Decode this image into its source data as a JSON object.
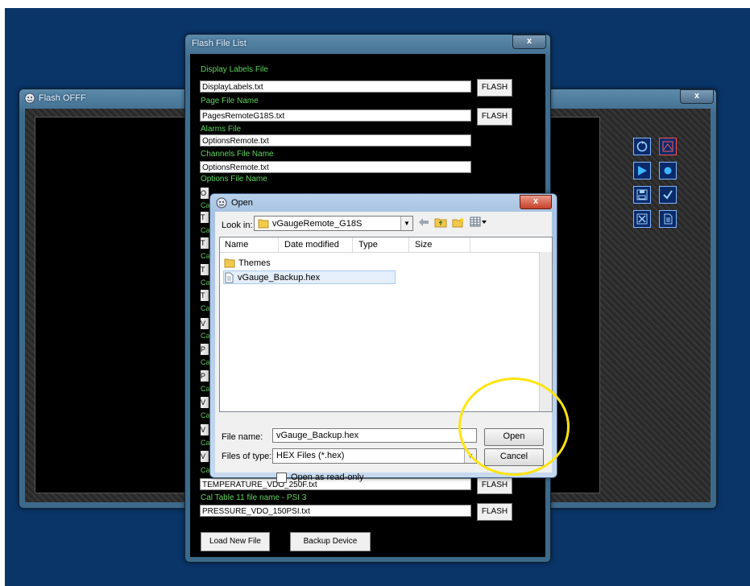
{
  "main_window": {
    "title": "Flash OFFF",
    "close": "x"
  },
  "file_list": {
    "title": "Flash File List",
    "close": "x",
    "fields": [
      {
        "label": "Display Labels File",
        "value": "DisplayLabels.txt",
        "button": "FLASH"
      },
      {
        "label": "Page File Name",
        "value": "PagesRemoteG18S.txt",
        "button": "FLASH"
      },
      {
        "label": "Alarms File",
        "value": "OptionsRemote.txt"
      },
      {
        "label": "Channels File Name",
        "value": "OptionsRemote.txt"
      },
      {
        "label": "Options File Name"
      }
    ],
    "partial_rows": [
      {
        "label": "Ca",
        "value": "O"
      },
      {
        "label": "Ca",
        "value": "T"
      },
      {
        "label": "Ca",
        "value": "T"
      },
      {
        "label": "Ca",
        "value": "T"
      },
      {
        "label": "Ca",
        "value": "T"
      },
      {
        "label": "Ca",
        "value": "V"
      },
      {
        "label": "Ca",
        "value": "P"
      },
      {
        "label": "Ca",
        "value": "P"
      },
      {
        "label": "Ca",
        "value": "V"
      },
      {
        "label": "Ca",
        "value": "V"
      },
      {
        "label": "Ca",
        "value": "V"
      }
    ],
    "bottom_fields": [
      {
        "label": "Ca",
        "value": "TEMPERATURE_VDO_250F.txt",
        "button": "FLASH"
      },
      {
        "label": "Cal Table 11 file name - PSI 3",
        "value": "PRESSURE_VDO_150PSI.txt",
        "button": "FLASH"
      }
    ],
    "load_button": "Load New File",
    "backup_button": "Backup Device"
  },
  "open_dialog": {
    "title": "Open",
    "close": "x",
    "look_in_label": "Look in:",
    "look_in_value": "vGaugeRemote_G18S",
    "columns": [
      "Name",
      "Date modified",
      "Type",
      "Size"
    ],
    "items": [
      {
        "name": "Themes",
        "icon": "folder-icon"
      },
      {
        "name": "vGauge_Backup.hex",
        "icon": "file-icon",
        "selected": true
      }
    ],
    "file_name_label": "File name:",
    "file_name_value": "vGauge_Backup.hex",
    "file_type_label": "Files of type:",
    "file_type_value": "HEX Files (*.hex)",
    "read_only_label": "Open as read-only",
    "open_button": "Open",
    "cancel_button": "Cancel"
  },
  "colors": {
    "desktop": "#0a3569",
    "label_green": "#5fd45f",
    "highlight": "#ffe40f"
  }
}
